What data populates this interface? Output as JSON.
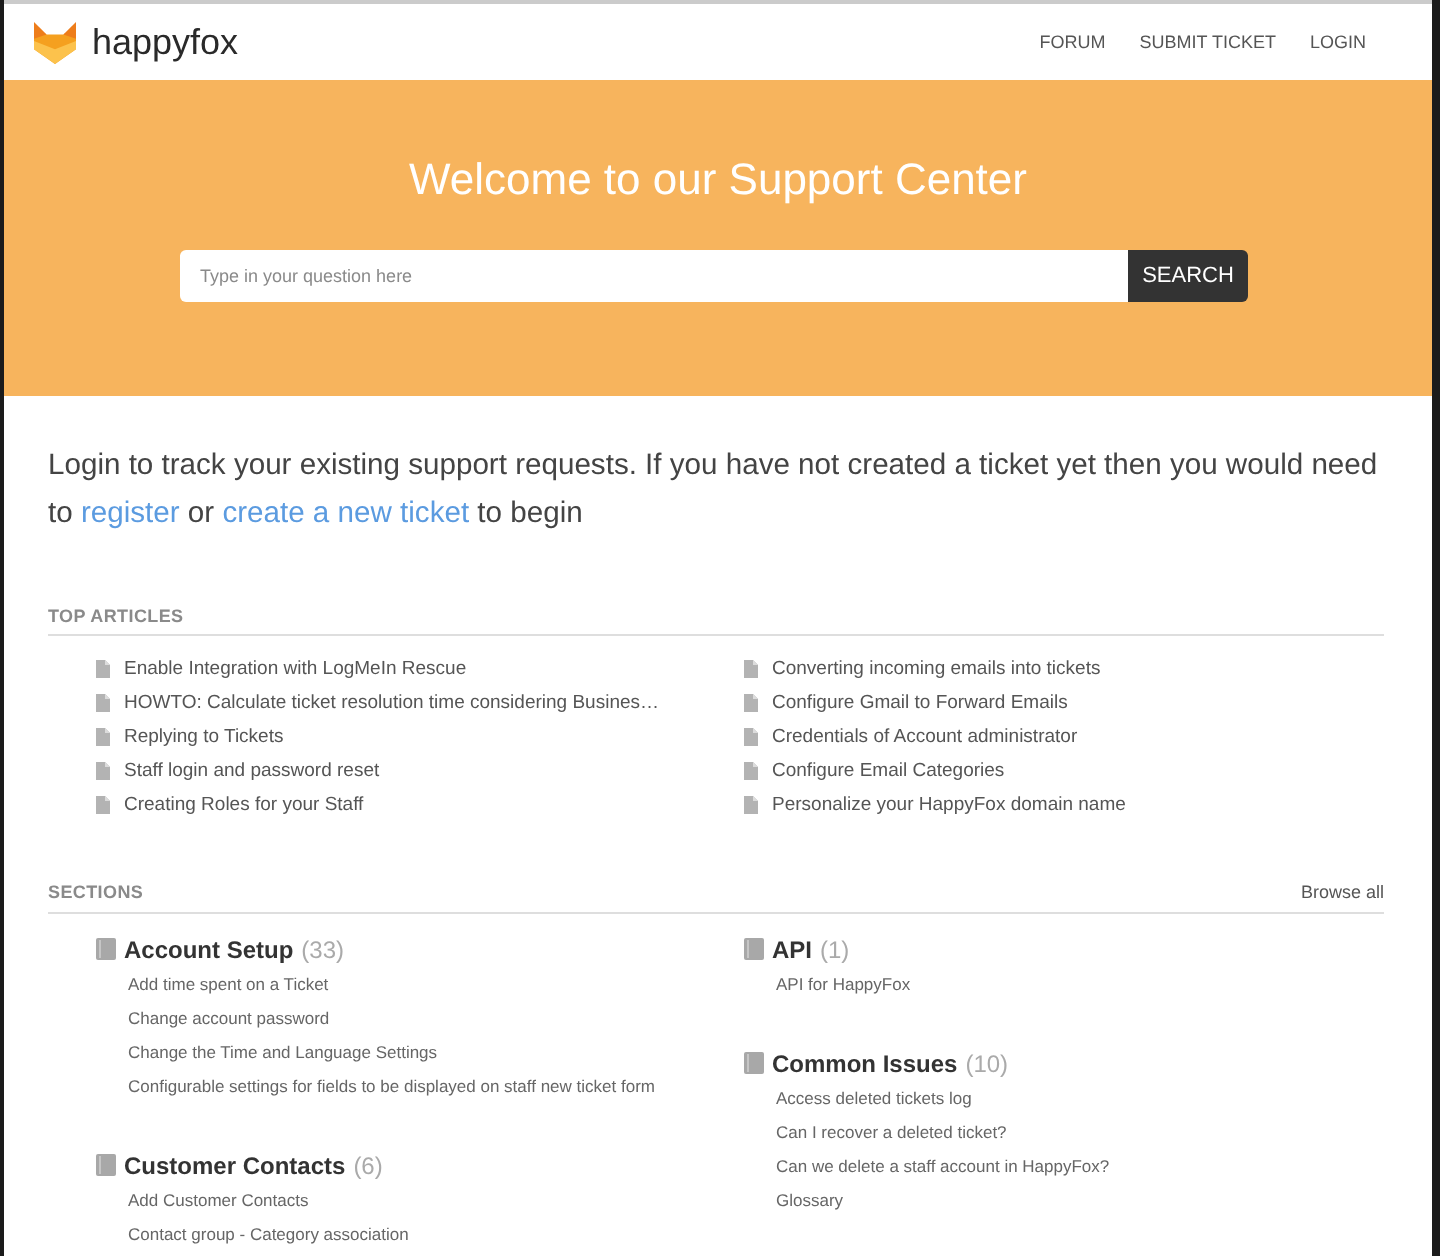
{
  "header": {
    "brand": "happyfox",
    "nav": [
      "FORUM",
      "SUBMIT TICKET",
      "LOGIN"
    ]
  },
  "hero": {
    "title": "Welcome to our Support Center",
    "search": {
      "placeholder": "Type in your question here",
      "button": "SEARCH"
    }
  },
  "intro": [
    {
      "kind": "text",
      "text": "Login to track your existing support requests. If you have not created a ticket yet then you would need to "
    },
    {
      "kind": "link",
      "text": "register"
    },
    {
      "kind": "text",
      "text": " or "
    },
    {
      "kind": "link",
      "text": "create a new ticket"
    },
    {
      "kind": "text",
      "text": " to begin"
    }
  ],
  "top_articles": {
    "heading": "TOP ARTICLES",
    "columns": [
      [
        "Enable Integration with LogMeIn Rescue",
        "HOWTO: Calculate ticket resolution time considering Busines…",
        "Replying to Tickets",
        "Staff login and password reset",
        "Creating Roles for your Staff"
      ],
      [
        "Converting incoming emails into tickets",
        "Configure Gmail to Forward Emails",
        "Credentials of Account administrator",
        "Configure Email Categories",
        "Personalize your HappyFox domain name"
      ]
    ]
  },
  "sections": {
    "heading": "SECTIONS",
    "browse_all": "Browse all",
    "columns": [
      [
        {
          "title": "Account Setup",
          "count": "(33)",
          "articles": [
            "Add time spent on a Ticket",
            "Change account password",
            "Change the Time and Language Settings",
            "Configurable settings for fields to be displayed on staff new ticket form"
          ]
        },
        {
          "title": "Customer Contacts",
          "count": "(6)",
          "articles": [
            "Add Customer Contacts",
            "Contact group - Category association"
          ]
        }
      ],
      [
        {
          "title": "API",
          "count": "(1)",
          "articles": [
            "API for HappyFox"
          ]
        },
        {
          "title": "Common Issues",
          "count": "(10)",
          "articles": [
            "Access deleted tickets log",
            "Can I recover a deleted ticket?",
            "Can we delete a staff account in HappyFox?",
            "Glossary"
          ]
        }
      ]
    ]
  }
}
